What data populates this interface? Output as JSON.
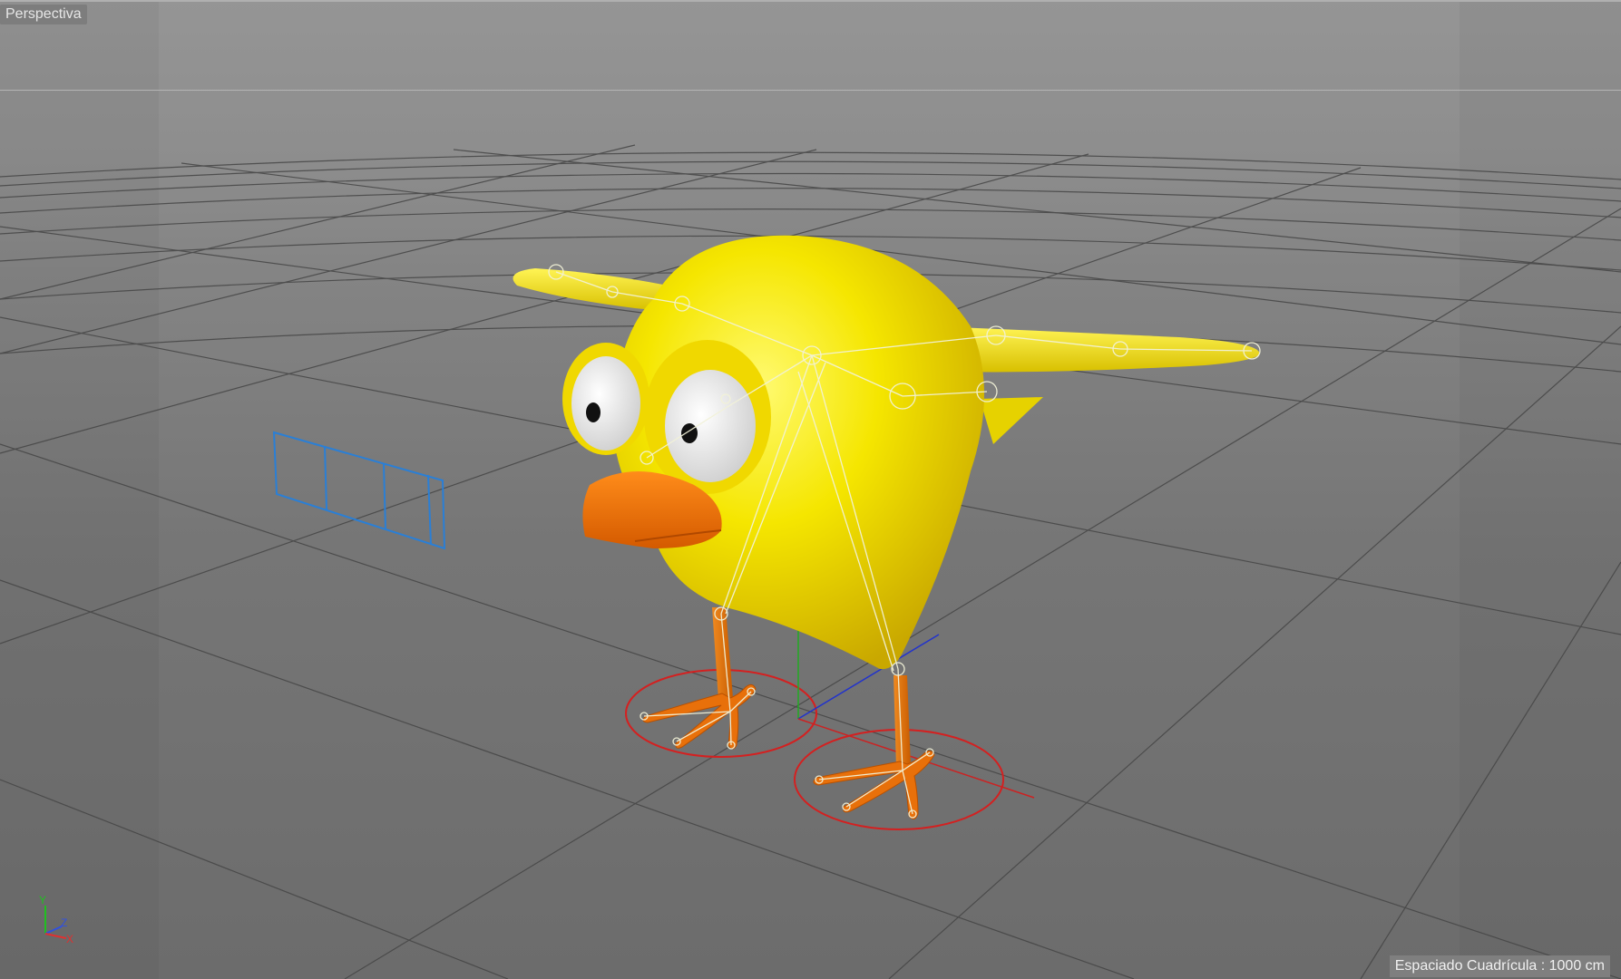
{
  "viewport": {
    "view_name": "Perspectiva",
    "grid_spacing": "Espaciado Cuadrícula : 1000 cm"
  },
  "axis_gizmo": {
    "y": "Y",
    "z": "Z",
    "x": "X"
  },
  "colors": {
    "background_top": "#959595",
    "background_bottom": "#6c6c6c",
    "grid": "#3f3f3f",
    "character_body": "#f0e000",
    "beak_and_feet": "#e8700a",
    "joint_lines": "#eeeecc",
    "ik_circles": "#d42020",
    "camera_wireframe": "#2a7fd6"
  }
}
